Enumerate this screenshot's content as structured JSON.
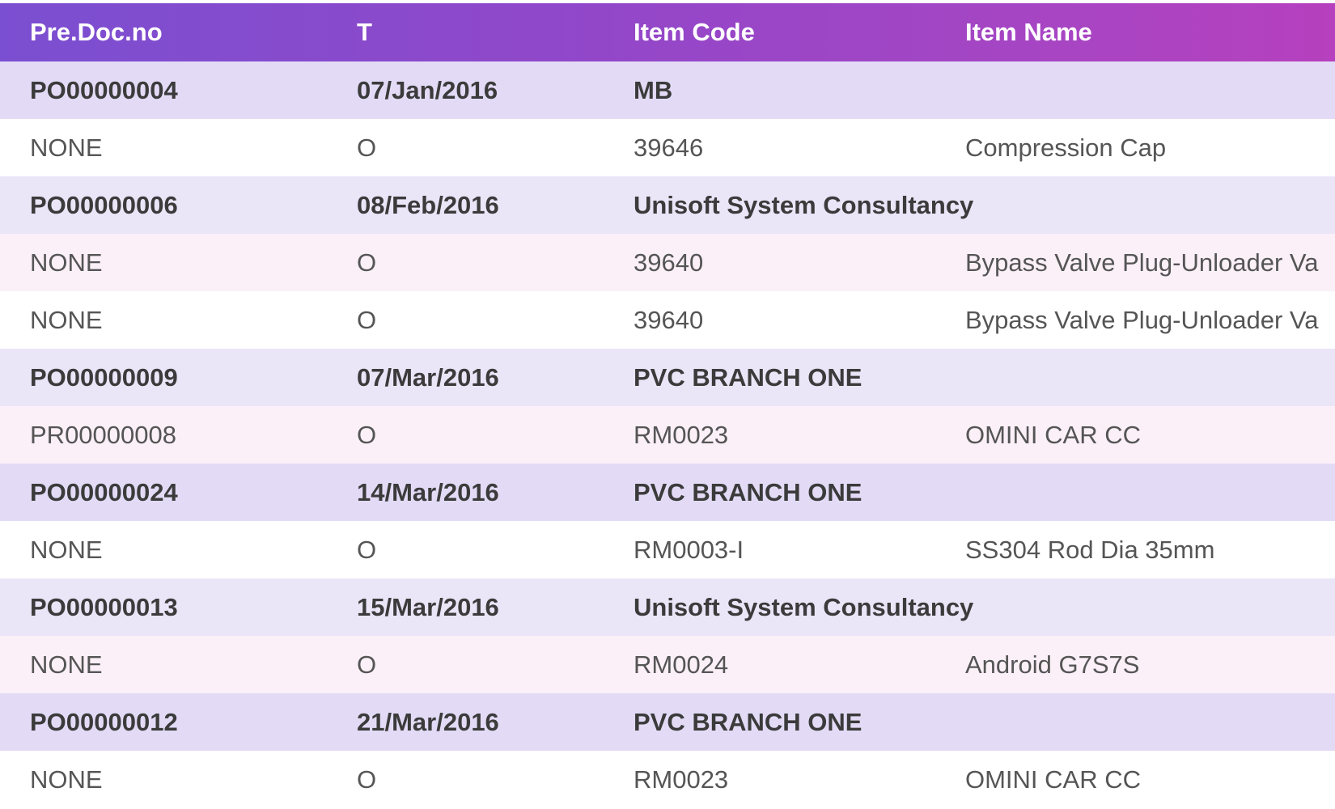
{
  "table": {
    "columns": [
      "Pre.Doc.no",
      "T",
      "Item Code",
      "Item Name"
    ],
    "rows": [
      {
        "kind": "group",
        "cells": [
          "PO00000004",
          "07/Jan/2016",
          "MB",
          ""
        ]
      },
      {
        "kind": "item",
        "cells": [
          "NONE",
          "O",
          "39646",
          "Compression Cap"
        ]
      },
      {
        "kind": "group",
        "cells": [
          "PO00000006",
          "08/Feb/2016",
          "Unisoft System Consultancy",
          ""
        ]
      },
      {
        "kind": "item",
        "cells": [
          "NONE",
          "O",
          "39640",
          "Bypass Valve Plug-Unloader Va"
        ]
      },
      {
        "kind": "item",
        "cells": [
          "NONE",
          "O",
          "39640",
          "Bypass Valve Plug-Unloader Va"
        ]
      },
      {
        "kind": "group",
        "cells": [
          "PO00000009",
          "07/Mar/2016",
          "PVC BRANCH ONE",
          ""
        ]
      },
      {
        "kind": "item",
        "cells": [
          "PR00000008",
          "O",
          "RM0023",
          "OMINI CAR CC"
        ]
      },
      {
        "kind": "group",
        "cells": [
          "PO00000024",
          "14/Mar/2016",
          "PVC BRANCH ONE",
          ""
        ]
      },
      {
        "kind": "item",
        "cells": [
          "NONE",
          "O",
          "RM0003-I",
          "SS304 Rod Dia 35mm"
        ]
      },
      {
        "kind": "group",
        "cells": [
          "PO00000013",
          "15/Mar/2016",
          "Unisoft System Consultancy",
          ""
        ]
      },
      {
        "kind": "item",
        "cells": [
          "NONE",
          "O",
          "RM0024",
          "Android G7S7S"
        ]
      },
      {
        "kind": "group",
        "cells": [
          "PO00000012",
          "21/Mar/2016",
          "PVC BRANCH ONE",
          ""
        ]
      },
      {
        "kind": "item",
        "cells": [
          "NONE",
          "O",
          "RM0023",
          "OMINI CAR CC"
        ]
      }
    ]
  },
  "colors": {
    "header_gradient_start": "#7b4fd1",
    "header_gradient_end": "#b640be",
    "group_row": "#e3dbf6",
    "group_row_alt": "#ebe5f8",
    "item_row_pink": "#fbf0f8",
    "item_row_white": "#ffffff"
  }
}
